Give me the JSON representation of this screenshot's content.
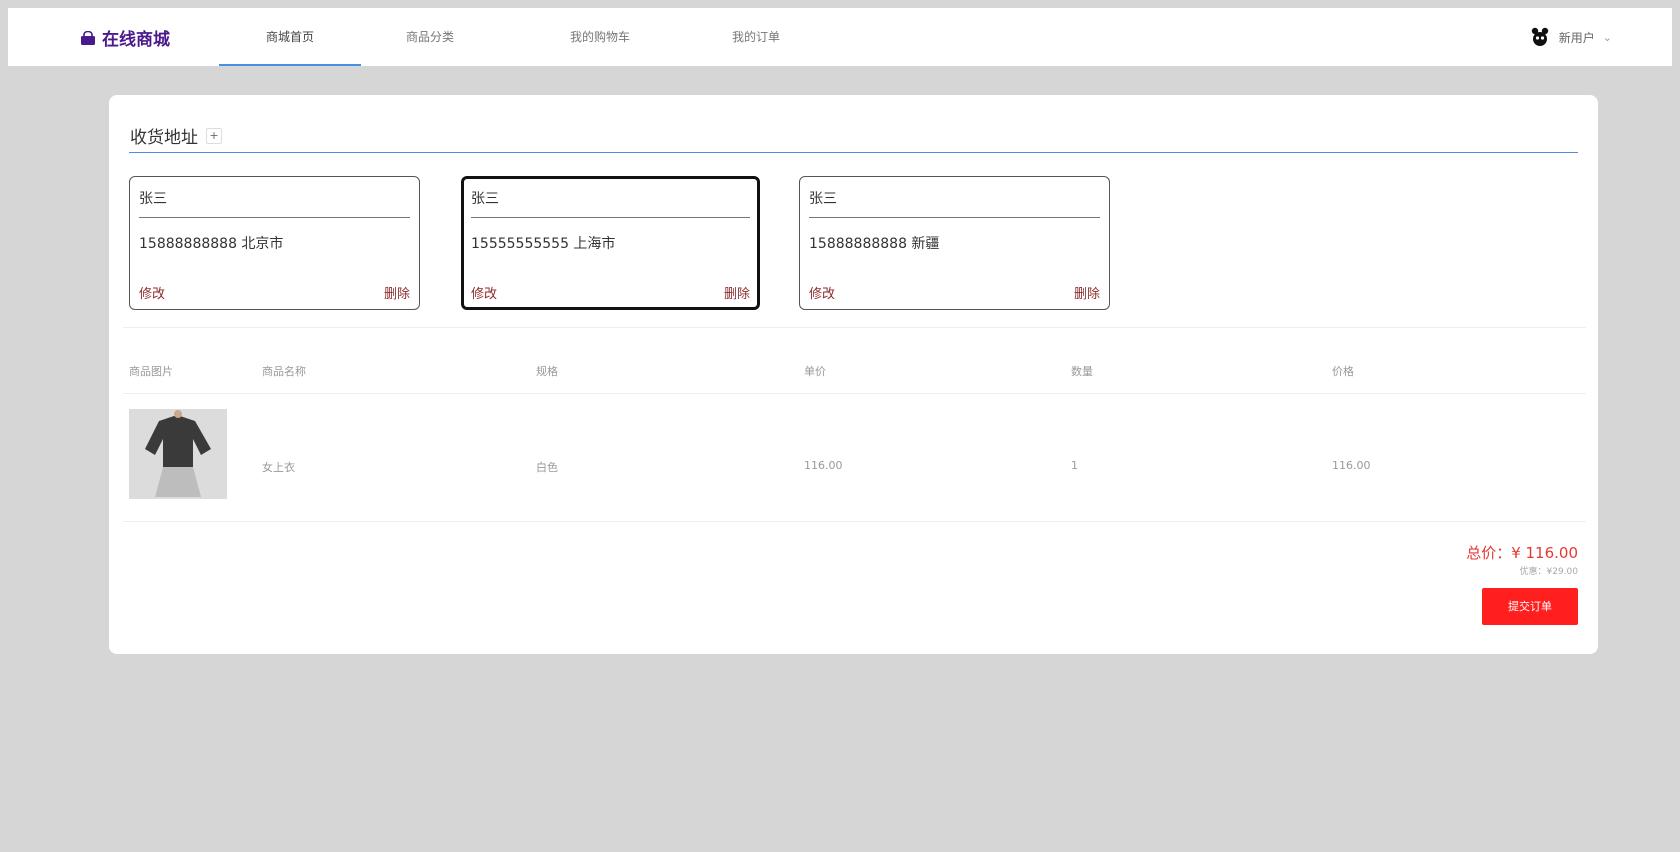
{
  "brand": {
    "icon": "shopping-bag-icon",
    "name": "在线商城",
    "color": "#4a1a8c"
  },
  "nav": {
    "tabs": [
      {
        "label": "商城首页",
        "active": true
      },
      {
        "label": "商品分类",
        "active": false
      },
      {
        "label": "我的购物车",
        "active": false
      },
      {
        "label": "我的订单",
        "active": false
      }
    ]
  },
  "user": {
    "avatar": "avatar-icon",
    "name": "新用户",
    "chevron": "⌄"
  },
  "address": {
    "title": "收货地址",
    "add_label": "+",
    "cards": [
      {
        "name": "张三",
        "detail": "15888888888 北京市",
        "edit": "修改",
        "delete": "删除",
        "selected": false
      },
      {
        "name": "张三",
        "detail": "15555555555 上海市",
        "edit": "修改",
        "delete": "删除",
        "selected": true
      },
      {
        "name": "张三",
        "detail": "15888888888 新疆",
        "edit": "修改",
        "delete": "删除",
        "selected": false
      }
    ]
  },
  "table": {
    "headers": [
      "商品图片",
      "商品名称",
      "规格",
      "单价",
      "数量",
      "价格"
    ],
    "rows": [
      {
        "name": "女上衣",
        "spec": "白色",
        "unit_price": "116.00",
        "qty": "1",
        "price": "116.00"
      }
    ]
  },
  "summary": {
    "total_label": "总价：",
    "total_value": "¥ 116.00",
    "discount_label": "优惠：",
    "discount_value": "¥29.00",
    "submit_label": "提交订单"
  },
  "colors": {
    "accent": "#4a90e2",
    "action_red": "#ff1f1f",
    "link_red": "#8b2c2c"
  }
}
